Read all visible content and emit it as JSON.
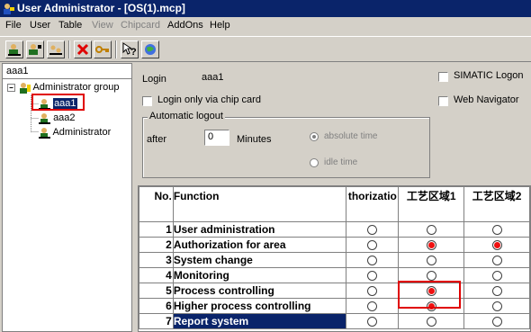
{
  "window": {
    "title": "User Administrator - [OS(1).mcp]"
  },
  "menu": [
    {
      "label": "File",
      "disabled": false
    },
    {
      "label": "User",
      "disabled": false
    },
    {
      "label": "Table",
      "disabled": false
    },
    {
      "label": "View",
      "disabled": false
    },
    {
      "label": "Chipcard",
      "disabled": true
    },
    {
      "label": "AddOns",
      "disabled": false
    },
    {
      "label": "Help",
      "disabled": false
    }
  ],
  "toolbar": {
    "icons": [
      "add-user-icon",
      "add-group-icon",
      "copy-user-icon",
      "delete-icon",
      "key-icon",
      "help-icon",
      "web-icon"
    ]
  },
  "tree": {
    "header": "aaa1",
    "group": "Administrator group",
    "users": [
      "aaa1",
      "aaa2",
      "Administrator"
    ]
  },
  "form": {
    "login_label": "Login",
    "login_value": "aaa1",
    "simatic_logon": "SIMATIC Logon",
    "chip_card_only": "Login only via chip card",
    "web_navigator": "Web Navigator",
    "auto_logout_title": "Automatic logout",
    "after_label": "after",
    "after_value": "0",
    "minutes_label": "Minutes",
    "absolute_time": "absolute time",
    "idle_time": "idle time"
  },
  "grid": {
    "headers": [
      "No.",
      "Function",
      "thorizatio",
      "工艺区域1",
      "工艺区域2"
    ],
    "rows": [
      {
        "no": "1",
        "function": "User administration",
        "a": false,
        "b": false,
        "c": false
      },
      {
        "no": "2",
        "function": "Authorization for area",
        "a": false,
        "b": true,
        "c": true
      },
      {
        "no": "3",
        "function": "System change",
        "a": false,
        "b": false,
        "c": false
      },
      {
        "no": "4",
        "function": "Monitoring",
        "a": false,
        "b": false,
        "c": false
      },
      {
        "no": "5",
        "function": "Process controlling",
        "a": false,
        "b": true,
        "c": false
      },
      {
        "no": "6",
        "function": "Higher process controlling",
        "a": false,
        "b": true,
        "c": false
      },
      {
        "no": "7",
        "function": "Report system",
        "a": false,
        "b": false,
        "c": false
      }
    ]
  },
  "colors": {
    "title_bar": "#0a246a",
    "highlight": "#e00000",
    "radio_on": "#f01010"
  }
}
